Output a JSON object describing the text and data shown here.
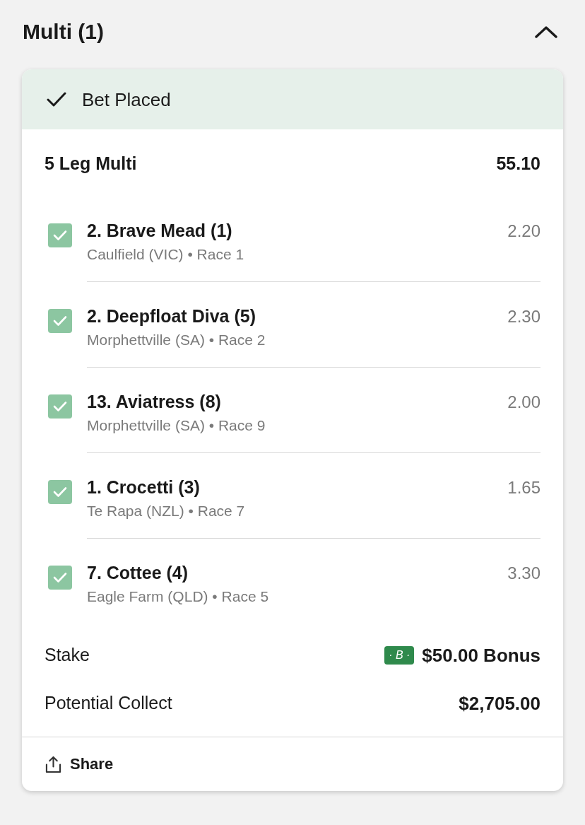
{
  "section": {
    "title": "Multi (1)",
    "expanded": true
  },
  "bet": {
    "status": "Bet Placed",
    "bet_type": "5 Leg Multi",
    "odds": "55.10",
    "legs": [
      {
        "selection": "2. Brave Mead (1)",
        "meeting": "Caulfield (VIC) • Race 1",
        "odds": "2.20",
        "checked": true
      },
      {
        "selection": "2. Deepfloat Diva (5)",
        "meeting": "Morphettville (SA) • Race 2",
        "odds": "2.30",
        "checked": true
      },
      {
        "selection": "13. Aviatress (8)",
        "meeting": "Morphettville (SA) • Race 9",
        "odds": "2.00",
        "checked": true
      },
      {
        "selection": "1. Crocetti (3)",
        "meeting": "Te Rapa (NZL) • Race 7",
        "odds": "1.65",
        "checked": true
      },
      {
        "selection": "7. Cottee (4)",
        "meeting": "Eagle Farm (QLD) • Race 5",
        "odds": "3.30",
        "checked": true
      }
    ],
    "stake": {
      "label": "Stake",
      "badge": "· B ·",
      "amount": "$50.00 Bonus"
    },
    "potential_collect": {
      "label": "Potential Collect",
      "amount": "$2,705.00"
    },
    "share": "Share"
  }
}
